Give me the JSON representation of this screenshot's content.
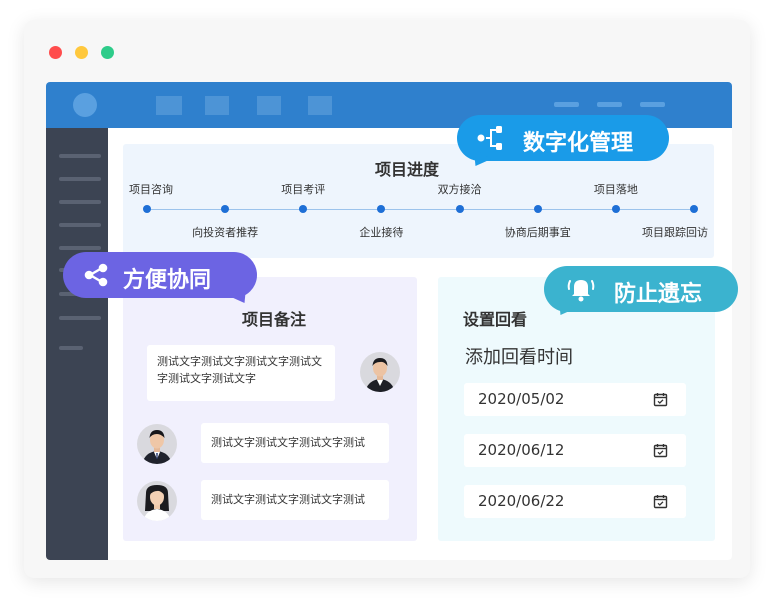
{
  "progress": {
    "title": "项目进度",
    "steps": [
      {
        "label": "项目咨询",
        "pos": "top"
      },
      {
        "label": "向投资者推荐",
        "pos": "bottom"
      },
      {
        "label": "项目考评",
        "pos": "top"
      },
      {
        "label": "企业接待",
        "pos": "bottom"
      },
      {
        "label": "双方接洽",
        "pos": "top"
      },
      {
        "label": "协商后期事宜",
        "pos": "bottom"
      },
      {
        "label": "项目落地",
        "pos": "top"
      },
      {
        "label": "项目跟踪回访",
        "pos": "bottom"
      }
    ]
  },
  "notes": {
    "title": "项目备注",
    "items": [
      {
        "text": "测试文字测试文字测试文字测试文字测试文字测试文字"
      },
      {
        "text": "测试文字测试文字测试文字测试"
      },
      {
        "text": "测试文字测试文字测试文字测试"
      }
    ]
  },
  "review": {
    "title": "设置回看",
    "subtitle": "添加回看时间",
    "dates": [
      "2020/05/02",
      "2020/06/12",
      "2020/06/22"
    ]
  },
  "callouts": {
    "digital": "数字化管理",
    "collab": "方便协同",
    "reminder": "防止遗忘"
  },
  "colors": {
    "topbar": "#2f80cd",
    "sidebar": "#3c4453",
    "digital": "#1a9be8",
    "collab": "#6c64e3",
    "reminder": "#3bb3cf"
  }
}
